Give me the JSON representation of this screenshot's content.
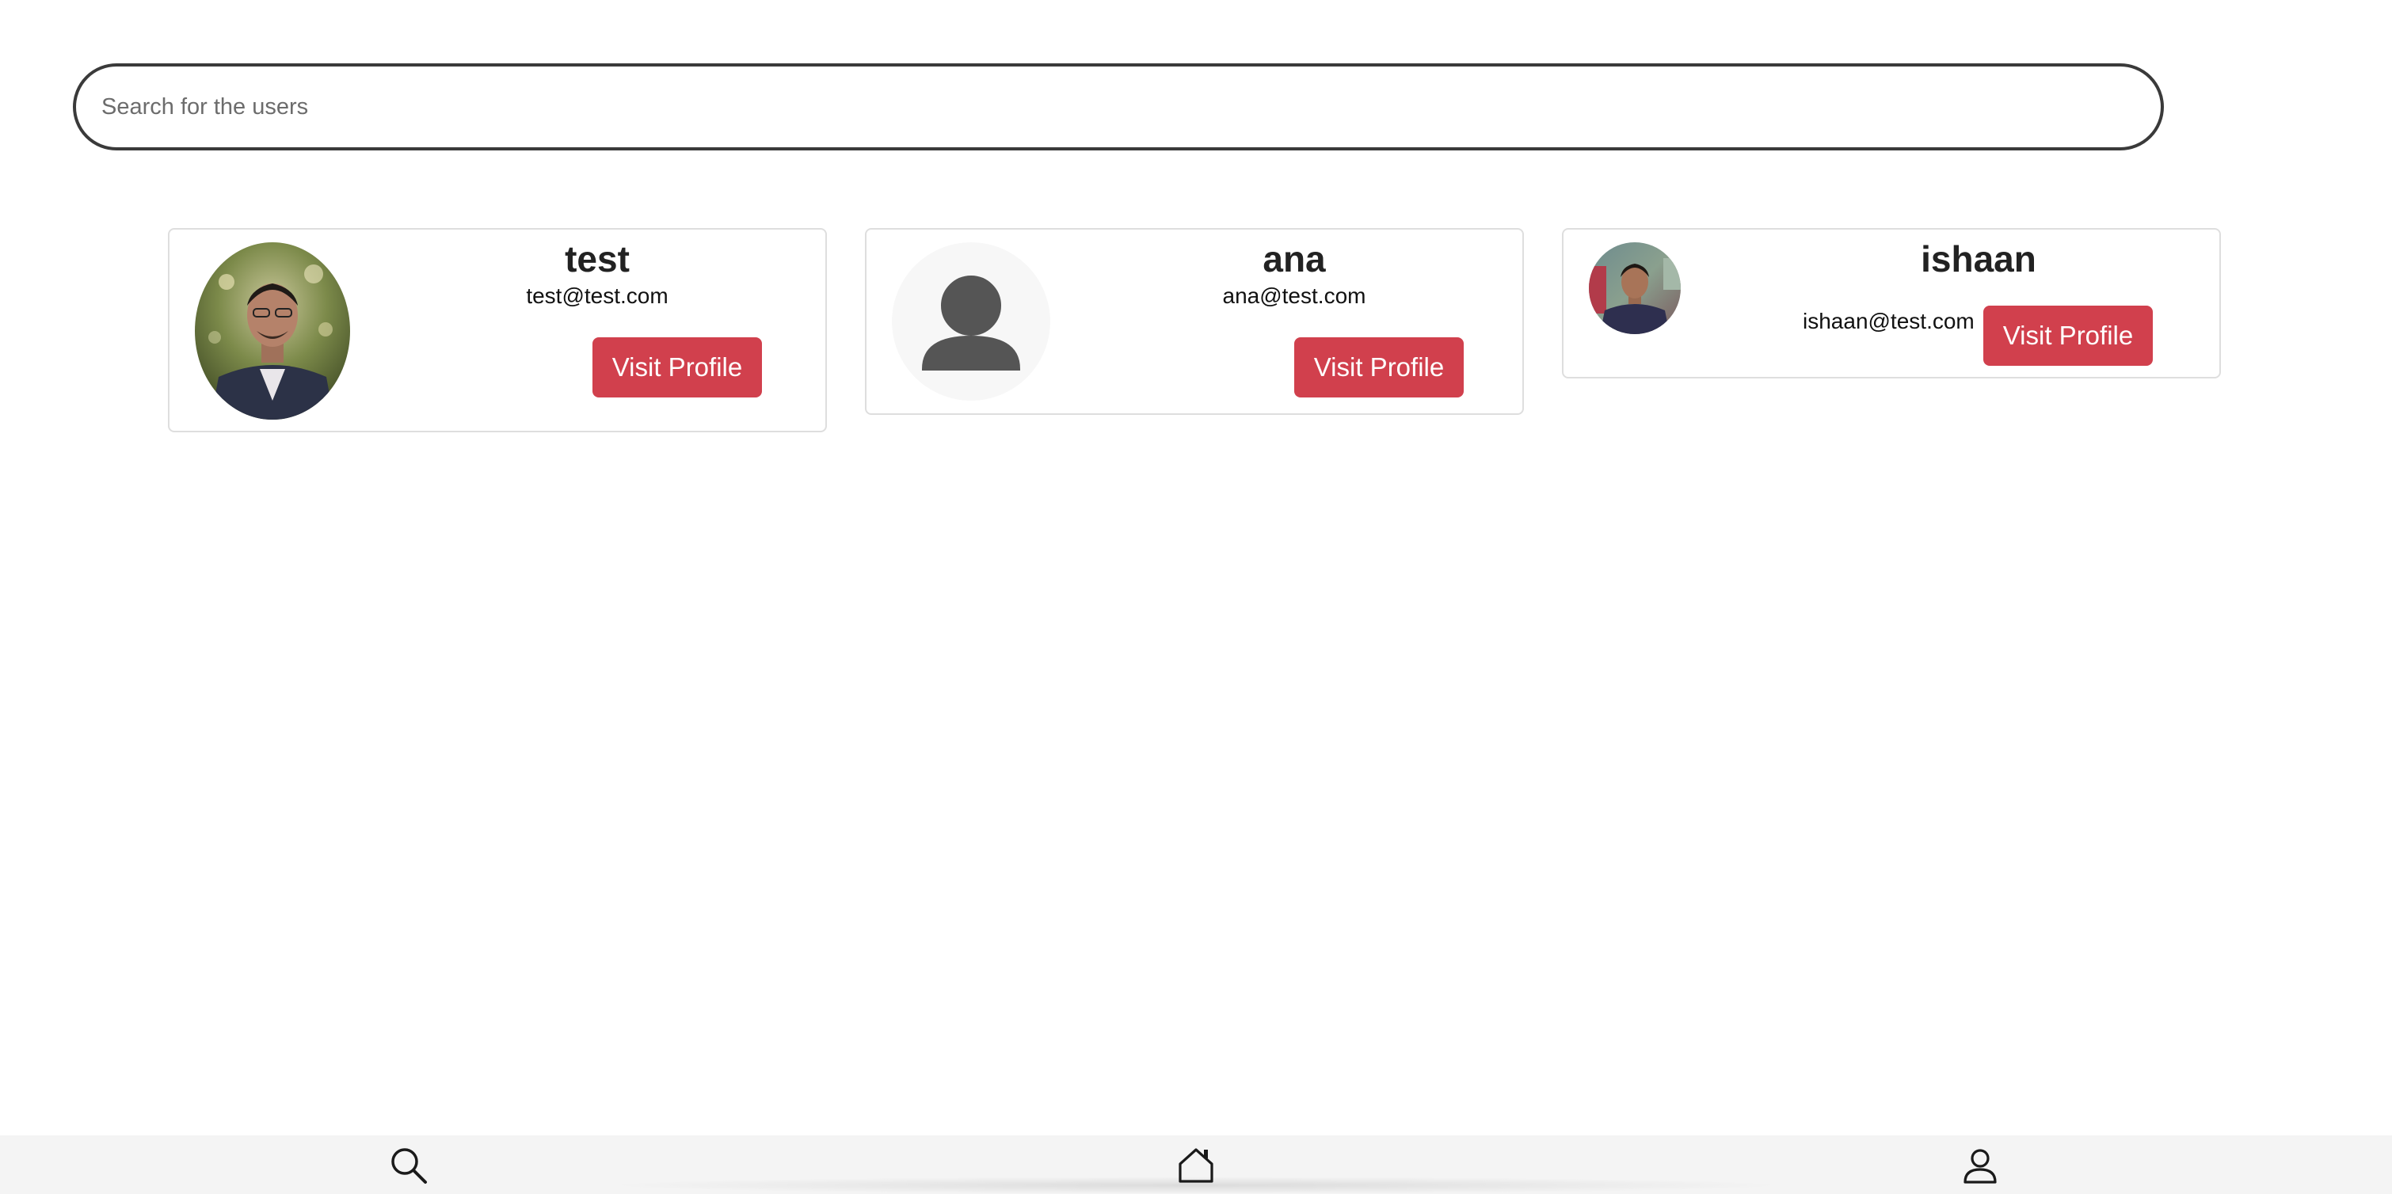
{
  "search": {
    "placeholder": "Search for the users",
    "value": ""
  },
  "users": [
    {
      "name": "test",
      "email": "test@test.com",
      "button_label": "Visit Profile",
      "avatar": "photo-avatar"
    },
    {
      "name": "ana",
      "email": "ana@test.com",
      "button_label": "Visit Profile",
      "avatar": "default-user-avatar"
    },
    {
      "name": "ishaan",
      "email": "ishaan@test.com",
      "button_label": "Visit Profile",
      "avatar": "photo-avatar"
    }
  ],
  "nav": {
    "items": [
      {
        "icon": "search-icon"
      },
      {
        "icon": "home-icon"
      },
      {
        "icon": "profile-icon"
      }
    ]
  },
  "colors": {
    "accent": "#d1404d",
    "nav_bg": "#f4f4f4",
    "card_border": "#dedede"
  }
}
